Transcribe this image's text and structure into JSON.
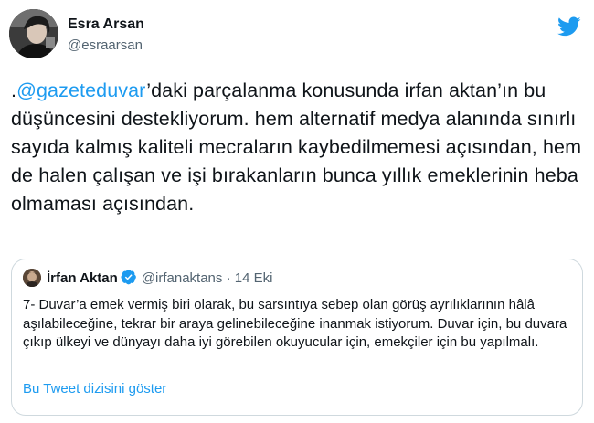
{
  "author": {
    "display_name": "Esra Arsan",
    "handle": "@esraarsan"
  },
  "tweet": {
    "lead": ".",
    "mention": "@gazeteduvar",
    "text": "’daki parçalanma konusunda irfan aktan’ın bu düşüncesini destekliyorum. hem alternatif medya alanında sınırlı sayıda kalmış kaliteli mecraların kaybedilmemesi açısından, hem de halen çalışan ve işi bırakanların bunca yıllık emeklerinin heba olmaması açısından."
  },
  "quoted_tweet": {
    "display_name": "İrfan Aktan",
    "handle": "@irfanaktans",
    "separator": "·",
    "date": "14 Eki",
    "text": "7- Duvar’a emek vermiş biri olarak, bu sarsıntıya sebep olan görüş ayrılıklarının hâlâ aşılabileceğine, tekrar bir araya gelinebileceğine inanmak istiyorum. Duvar için, bu duvara çıkıp ülkeyi ve dünyayı daha iyi görebilen okuyucular için, emekçiler için bu yapılmalı.",
    "show_thread_label": "Bu Tweet dizisini göster"
  },
  "icons": {
    "brand": "twitter-bird-icon",
    "verified": "verified-badge-icon"
  },
  "colors": {
    "accent": "#1d9bf0",
    "text": "#0f1419",
    "secondary": "#536471",
    "border": "#cfd9de"
  }
}
